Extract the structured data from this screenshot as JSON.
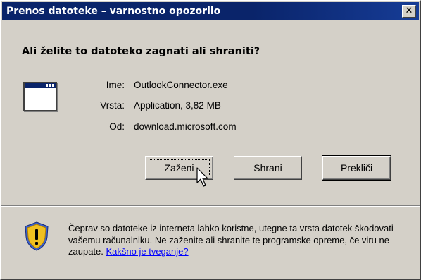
{
  "window": {
    "title": "Prenos datoteke – varnostno opozorilo",
    "close_symbol": "✕",
    "close_icon": "close-icon"
  },
  "question": "Ali želite to datoteko zagnati ali shraniti?",
  "file_info": {
    "icon": "application-window-icon",
    "name_label": "Ime:",
    "name_value": "OutlookConnector.exe",
    "type_label": "Vrsta:",
    "type_value": "Application, 3,82 MB",
    "from_label": "Od:",
    "from_value": "download.microsoft.com"
  },
  "buttons": {
    "run": "Zaženi",
    "save": "Shrani",
    "cancel": "Prekliči"
  },
  "warning": {
    "icon": "security-shield-warning-icon",
    "text": "Čeprav so datoteke iz interneta lahko koristne, utegne ta vrsta datotek škodovati vašemu računalniku. Ne zaženite ali shranite te programske opreme, če viru ne zaupate. ",
    "link_text": "Kakšno je tveganje?"
  },
  "colors": {
    "titlebar": "#0a246a",
    "dialog_face": "#d4d0c8",
    "link": "#0000ff"
  }
}
